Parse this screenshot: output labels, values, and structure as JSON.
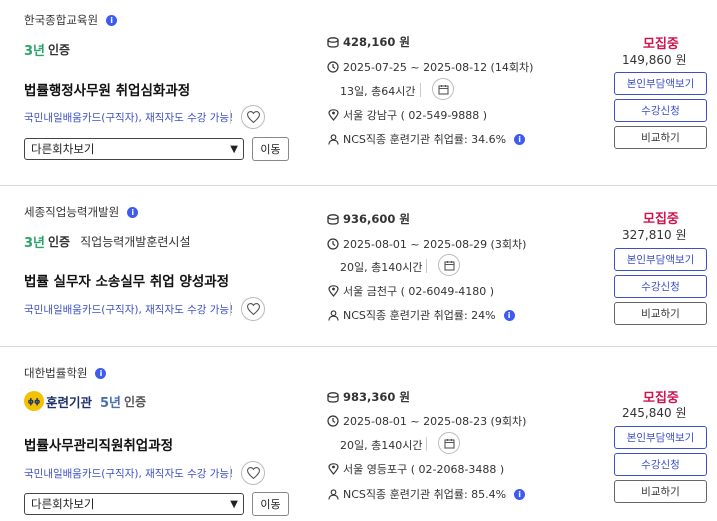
{
  "colors": {
    "status": "#d0134d",
    "link": "#3d50c8",
    "cert": "#2aa36b",
    "info": "#3d5af1"
  },
  "icons": {
    "info": "info-circle-icon",
    "heart": "heart-icon",
    "price": "coin-icon",
    "clock": "clock-icon",
    "calendar": "calendar-icon",
    "location": "location-pin-icon",
    "person": "person-icon"
  },
  "courses": [
    {
      "institution": "한국종합교육원",
      "cert_years": "3년",
      "cert_label": "인증",
      "cert_extra": "",
      "title": "법률행정사무원 취업심화과정",
      "card_note": "국민내일배움카드(구직자), 재직자도 수강 가능!",
      "select_label": "다른회차보기",
      "move_label": "이동",
      "price": "428,160 원",
      "period": "2025-07-25 ~ 2025-08-12 (14회차)",
      "duration": "13일, 총64시간",
      "location": "서울 강남구 ( 02-549-9888 )",
      "employment": "NCS직종 훈련기관 취업률: 34.6%",
      "status": "모집중",
      "subsidy": "149,860 원",
      "buttons": [
        "본인부담액보기",
        "수강신청",
        "비교하기"
      ]
    },
    {
      "institution": "세종직업능력개발원",
      "cert_years": "3년",
      "cert_label": "인증",
      "cert_extra": "직업능력개발훈련시설",
      "title": "법률 실무자 소송실무 취업 양성과정",
      "card_note": "국민내일배움카드(구직자), 재직자도 수강 가능!",
      "select_label": "",
      "move_label": "",
      "price": "936,600 원",
      "period": "2025-08-01 ~ 2025-08-29 (3회차)",
      "duration": "20일, 총140시간",
      "location": "서울 금천구 ( 02-6049-4180 )",
      "employment": "NCS직종 훈련기관 취업률: 24%",
      "status": "모집중",
      "subsidy": "327,810 원",
      "buttons": [
        "본인부담액보기",
        "수강신청",
        "비교하기"
      ]
    },
    {
      "institution": "대한법률학원",
      "cert_years": "5년",
      "cert_label": "인증",
      "cert_badge": "훈련기관",
      "cert_extra": "",
      "title": "법률사무관리직원취업과정",
      "card_note": "국민내일배움카드(구직자), 재직자도 수강 가능!",
      "select_label": "다른회차보기",
      "move_label": "이동",
      "price": "983,360 원",
      "period": "2025-08-01 ~ 2025-08-23 (9회차)",
      "duration": "20일, 총140시간",
      "location": "서울 영등포구 ( 02-2068-3488 )",
      "employment": "NCS직종 훈련기관 취업률: 85.4%",
      "status": "모집중",
      "subsidy": "245,840 원",
      "buttons": [
        "본인부담액보기",
        "수강신청",
        "비교하기"
      ]
    }
  ]
}
